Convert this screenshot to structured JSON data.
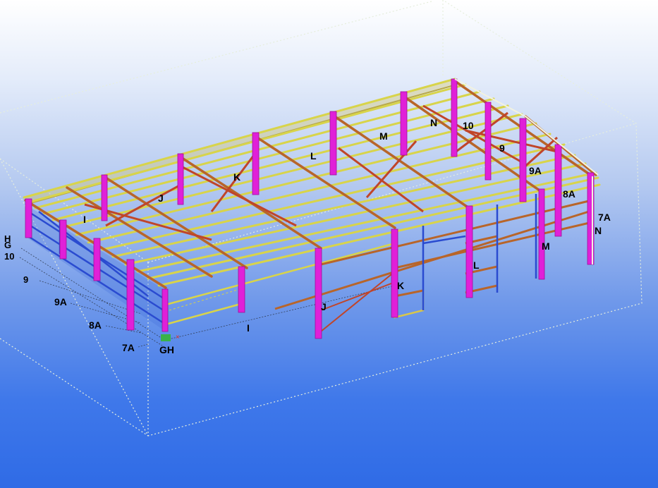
{
  "viewport": {
    "grid_labels": {
      "row_ends": [
        "H",
        "G",
        "10",
        "9",
        "9A",
        "8A",
        "7A",
        "GH"
      ],
      "column_front": [
        "I",
        "J",
        "K",
        "L",
        "M",
        "N"
      ],
      "roof_columns": [
        "I",
        "J",
        "K",
        "L",
        "M",
        "N",
        "10"
      ],
      "right_rows": [
        "9",
        "9A",
        "8A",
        "7A"
      ]
    },
    "colors": {
      "column": "#e020d8",
      "purlin": "#d6d24a",
      "rafter": "#b8652a",
      "brace": "#c0452a",
      "girt_blue": "#2a4bd0",
      "wire": "#dfe6d8"
    }
  }
}
